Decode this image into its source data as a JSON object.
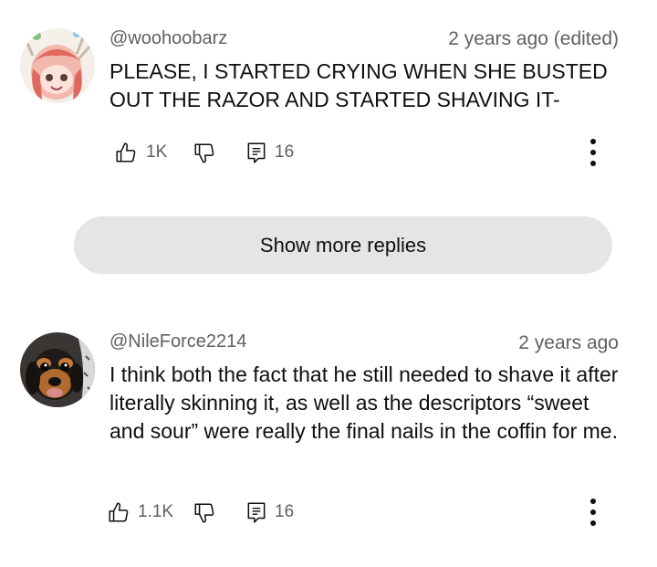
{
  "comments": [
    {
      "handle": "@woohoobarz",
      "time": "2 years ago (edited)",
      "text": "PLEASE, I STARTED CRYING WHEN SHE BUSTED OUT THE RAZOR AND STARTED SHAVING IT-",
      "likes": "1K",
      "replies": "16",
      "avatar_icon": "anime-character-avatar",
      "like_icon": "thumbs-up-icon",
      "dislike_icon": "thumbs-down-icon",
      "reply_icon": "reply-comment-icon",
      "menu_icon": "more-vertical-icon"
    },
    {
      "handle": "@NileForce2214",
      "time": "2 years ago",
      "text": "I think both the fact that he still needed to shave it after literally skinning it, as well as the descriptors “sweet and sour” were really the final nails in the coffin for me.",
      "likes": "1.1K",
      "replies": "16",
      "avatar_icon": "dog-photo-avatar",
      "like_icon": "thumbs-up-icon",
      "dislike_icon": "thumbs-down-icon",
      "reply_icon": "reply-comment-icon",
      "menu_icon": "more-vertical-icon"
    }
  ],
  "show_more_replies": "Show more replies",
  "colors": {
    "text_primary": "#0f0f0f",
    "text_secondary": "#606060",
    "button_bg": "#e5e5e5",
    "background": "#ffffff"
  }
}
